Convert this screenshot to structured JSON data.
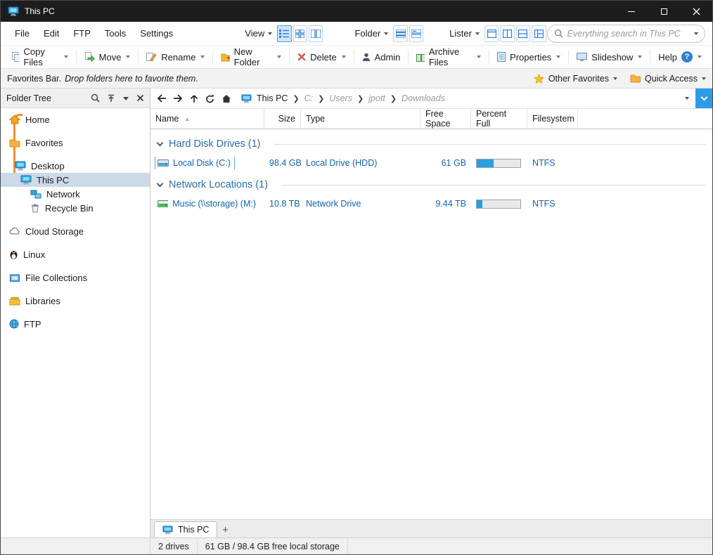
{
  "window": {
    "title": "This PC"
  },
  "menubar": {
    "items": [
      "File",
      "Edit",
      "FTP",
      "Tools",
      "Settings"
    ],
    "view_label": "View",
    "folder_label": "Folder",
    "lister_label": "Lister"
  },
  "search": {
    "placeholder": "Everything search in This PC"
  },
  "toolbar": {
    "buttons": [
      {
        "label": "Copy Files"
      },
      {
        "label": "Move"
      },
      {
        "label": "Rename"
      },
      {
        "label": "New Folder"
      },
      {
        "label": "Delete"
      },
      {
        "label": "Admin"
      },
      {
        "label": "Archive Files"
      },
      {
        "label": "Properties"
      },
      {
        "label": "Slideshow"
      },
      {
        "label": "Help"
      }
    ]
  },
  "favorites_bar": {
    "label": "Favorites Bar.",
    "hint": "Drop folders here to favorite them.",
    "other_favorites_label": "Other Favorites",
    "quick_access_label": "Quick Access"
  },
  "folder_tree": {
    "title": "Folder Tree",
    "items": [
      {
        "label": "Home"
      },
      {
        "label": "Favorites"
      },
      {
        "label": "Desktop"
      },
      {
        "label": "This PC"
      },
      {
        "label": "Network"
      },
      {
        "label": "Recycle Bin"
      },
      {
        "label": "Cloud Storage"
      },
      {
        "label": "Linux"
      },
      {
        "label": "File Collections"
      },
      {
        "label": "Libraries"
      },
      {
        "label": "FTP"
      }
    ]
  },
  "pathbar": {
    "segments": [
      "This PC",
      "C:",
      "Users",
      "jpott",
      "Downloads"
    ]
  },
  "file_list": {
    "columns": [
      "Name",
      "Size",
      "Type",
      "Free Space",
      "Percent Full",
      "Filesystem"
    ],
    "sort_asc_glyph": "▲",
    "groups": [
      {
        "label": "Hard Disk Drives (1)",
        "rows": [
          {
            "name": "Local Disk (C:)",
            "size": "98.4 GB",
            "type": "Local Drive (HDD)",
            "free_space": "61 GB",
            "percent_full": 38,
            "filesystem": "NTFS"
          }
        ]
      },
      {
        "label": "Network Locations (1)",
        "rows": [
          {
            "name": "Music (\\\\storage) (M:)",
            "size": "10.8 TB",
            "type": "Network Drive",
            "free_space": "9.44 TB",
            "percent_full": 13,
            "filesystem": "NTFS"
          }
        ]
      }
    ]
  },
  "tabs": {
    "active": "This PC",
    "new_tab": "+"
  },
  "status_bar": {
    "drives": "2 drives",
    "storage": "61 GB / 98.4 GB free local storage"
  }
}
